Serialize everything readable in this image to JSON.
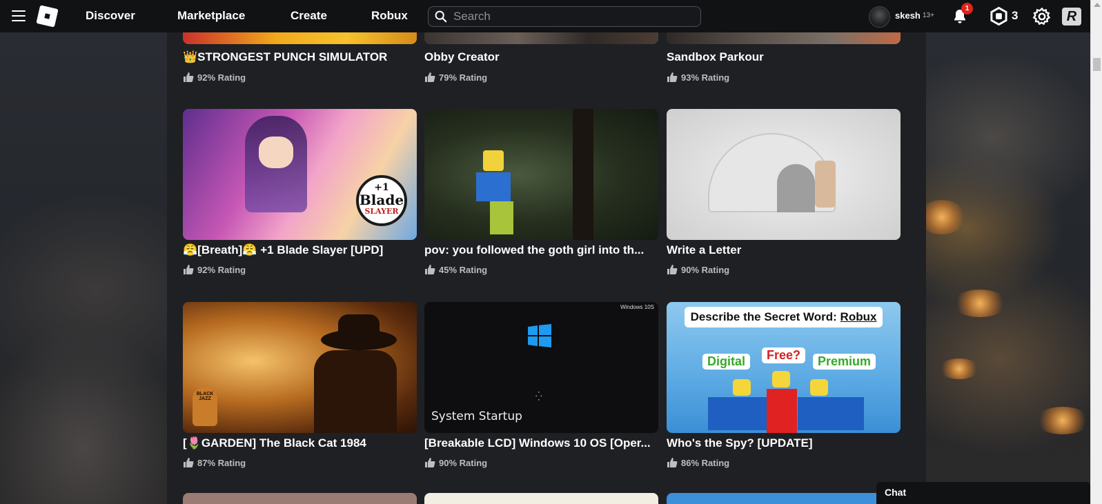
{
  "nav": {
    "discover": "Discover",
    "marketplace": "Marketplace",
    "create": "Create",
    "robux": "Robux"
  },
  "search": {
    "placeholder": "Search"
  },
  "user": {
    "name": "skesh",
    "age": "13+"
  },
  "notifications": {
    "count": "1"
  },
  "robux_balance": "3",
  "icons": [
    "menu-icon",
    "roblox-logo-icon",
    "search-icon",
    "avatar",
    "bell-icon",
    "robux-icon",
    "gear-icon",
    "r-icon",
    "thumbs-up-icon"
  ],
  "colors": {
    "topbar": "#111214",
    "content_bg": "#1f2024",
    "badge": "#e2231a"
  },
  "games_top": [
    {
      "title": "👑STRONGEST PUNCH SIMULATOR",
      "rating": "92% Rating"
    },
    {
      "title": "Obby Creator",
      "rating": "79% Rating"
    },
    {
      "title": "Sandbox Parkour",
      "rating": "93% Rating"
    }
  ],
  "games_mid": [
    {
      "title": "😤[Breath]😤 +1 Blade Slayer [UPD]",
      "rating": "92% Rating"
    },
    {
      "title": "pov: you followed the goth girl into th...",
      "rating": "45% Rating"
    },
    {
      "title": "Write a Letter",
      "rating": "90% Rating"
    }
  ],
  "games_bottom": [
    {
      "title": "[🌷GARDEN] The Black Cat 1984",
      "rating": "87% Rating"
    },
    {
      "title": "[Breakable LCD] Windows 10 OS [Oper...",
      "rating": "90% Rating"
    },
    {
      "title": "Who's the Spy? [UPDATE]",
      "rating": "86% Rating"
    }
  ],
  "thumb_text": {
    "blade": {
      "l1": "+1",
      "l2": "Blade",
      "l3": "SLAYER"
    },
    "windows": {
      "corner": "Windows 10S",
      "startup": "System Startup"
    },
    "spy": {
      "header_prefix": "Describe the Secret Word: ",
      "header_word": "Robux",
      "w1": "Digital",
      "w2": "Free?",
      "w3": "Premium"
    },
    "cat": {
      "sign": "BLACK JAZZ"
    }
  },
  "chat": {
    "label": "Chat"
  }
}
